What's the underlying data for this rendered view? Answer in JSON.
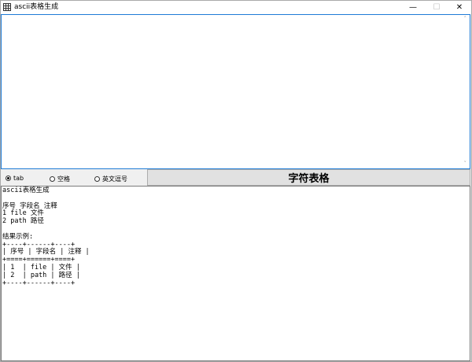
{
  "window": {
    "title": "ascii表格生成",
    "icon": "table-grid-icon",
    "controls": {
      "minimize": "—",
      "maximize": "☐",
      "close": "✕"
    }
  },
  "input": {
    "value": ""
  },
  "options": {
    "selected": "tab",
    "items": [
      {
        "label": "tab"
      },
      {
        "label": "空格"
      },
      {
        "label": "英文逗号"
      }
    ]
  },
  "generate_button": {
    "label": "字符表格"
  },
  "output": {
    "text": "ascii表格生成\n\n序号 字段名 注释\n1 file 文件\n2 path 路径\n\n结果示例:\n+----+------+----+\n| 序号 | 字段名 | 注释 |\n+====+======+====+\n| 1  | file | 文件 |\n| 2  | path | 路径 |\n+----+------+----+"
  }
}
